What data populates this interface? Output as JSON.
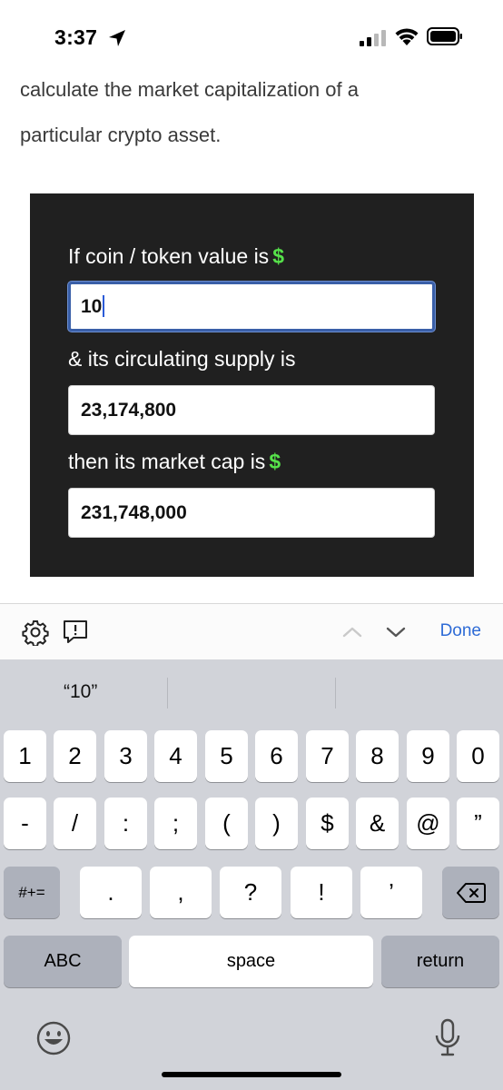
{
  "status_bar": {
    "time": "3:37",
    "icons": [
      "location-arrow-icon",
      "cellular-signal-icon",
      "wifi-icon",
      "battery-icon"
    ]
  },
  "article": {
    "line1": "calculate the market capitalization of a",
    "line2": "particular crypto asset."
  },
  "calculator": {
    "coin_label": "If coin / token value is",
    "coin_currency": "$",
    "coin_value": "10",
    "supply_label": "& its circulating supply is",
    "supply_value": "23,174,800",
    "market_cap_label": "then its market cap is",
    "market_cap_currency": "$",
    "market_cap_value": "231,748,000"
  },
  "accessory_bar": {
    "icons": [
      "gear-icon",
      "feedback-icon",
      "chevron-up-icon",
      "chevron-down-icon"
    ],
    "done_label": "Done"
  },
  "keyboard": {
    "suggestion": "“10”",
    "row1": [
      "1",
      "2",
      "3",
      "4",
      "5",
      "6",
      "7",
      "8",
      "9",
      "0"
    ],
    "row2": [
      "-",
      "/",
      ":",
      ";",
      "(",
      ")",
      "$",
      "&",
      "@",
      "”"
    ],
    "row3_left": "#+=",
    "row3": [
      ".",
      ",",
      "?",
      "!",
      "’"
    ],
    "abc_label": "ABC",
    "space_label": "space",
    "return_label": "return",
    "icons": [
      "backspace-icon",
      "emoji-icon",
      "microphone-icon"
    ],
    "colors": {
      "background": "#d1d3d9",
      "key": "#ffffff",
      "dark_key": "#adb1bb"
    }
  },
  "colors": {
    "accent_green": "#56e24a",
    "link_blue": "#2e6bd6",
    "widget_bg": "#202020"
  }
}
